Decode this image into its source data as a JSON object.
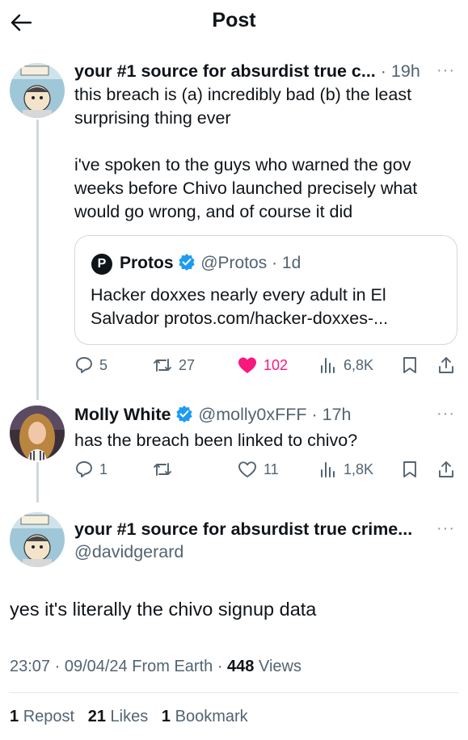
{
  "header": {
    "title": "Post",
    "back_icon": "arrow-left-icon"
  },
  "post1": {
    "author": "your #1 source for absurdist true c...",
    "time": "· 19h",
    "more": "···",
    "text_lines": [
      "this breach is (a) incredibly bad (b) the least",
      "surprising thing ever",
      "",
      "i've spoken to the guys who warned the gov",
      "weeks before Chivo launched precisely what",
      "would go wrong, and of course it did"
    ],
    "quote": {
      "logo_letter": "P",
      "name": "Protos",
      "handle": "@Protos",
      "time": "· 1d",
      "text_lines": [
        "Hacker doxxes nearly every adult in El",
        "Salvador protos.com/hacker-doxxes-..."
      ]
    },
    "actions": {
      "replies": "5",
      "reposts": "27",
      "likes": "102",
      "views": "6,8K"
    }
  },
  "post2": {
    "author": "Molly White",
    "handle": "@molly0xFFF",
    "time": "· 17h",
    "more": "···",
    "text": "has the breach been linked to chivo?",
    "actions": {
      "replies": "1",
      "reposts": "",
      "likes": "11",
      "views": "1,8K"
    }
  },
  "main": {
    "author": "your #1 source for absurdist true crime...",
    "handle": "@davidgerard",
    "more": "···",
    "text": "yes it's literally the chivo signup data",
    "meta_time": "23:07 · 09/04/24 From Earth ·",
    "views_count": "448",
    "views_label": "Views",
    "stats": {
      "reposts": "1",
      "reposts_label": "Repost",
      "likes": "21",
      "likes_label": "Likes",
      "bookmarks": "1",
      "bookmarks_label": "Bookmark"
    }
  },
  "colors": {
    "accent": "#1d9bf0",
    "like": "#f91880",
    "muted": "#536471"
  }
}
